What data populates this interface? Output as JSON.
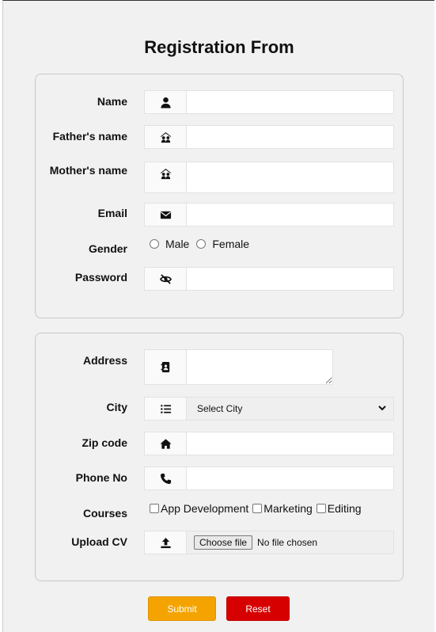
{
  "form": {
    "title": "Registration From",
    "personal": {
      "name": {
        "label": "Name",
        "icon": "user-icon",
        "value": ""
      },
      "father": {
        "label": "Father's name",
        "icon": "family-icon",
        "value": ""
      },
      "mother": {
        "label": "Mother's name",
        "icon": "family-icon",
        "value": ""
      },
      "email": {
        "label": "Email",
        "icon": "envelope-icon",
        "value": ""
      },
      "gender": {
        "label": "Gender",
        "options": [
          "Male",
          "Female"
        ]
      },
      "password": {
        "label": "Password",
        "icon": "eye-slash-icon",
        "value": ""
      }
    },
    "contact": {
      "address": {
        "label": "Address",
        "icon": "address-book-icon",
        "value": ""
      },
      "city": {
        "label": "City",
        "icon": "list-icon",
        "selected": "Select City"
      },
      "zip": {
        "label": "Zip code",
        "icon": "home-icon",
        "value": ""
      },
      "phone": {
        "label": "Phone No",
        "icon": "phone-icon",
        "value": ""
      },
      "courses": {
        "label": "Courses",
        "options": [
          "App Development",
          "Marketing",
          "Editing"
        ]
      },
      "cv": {
        "label": "Upload CV",
        "icon": "upload-icon",
        "button": "Choose file",
        "status": "No file chosen"
      }
    },
    "buttons": {
      "submit": "Submit",
      "reset": "Reset"
    }
  }
}
